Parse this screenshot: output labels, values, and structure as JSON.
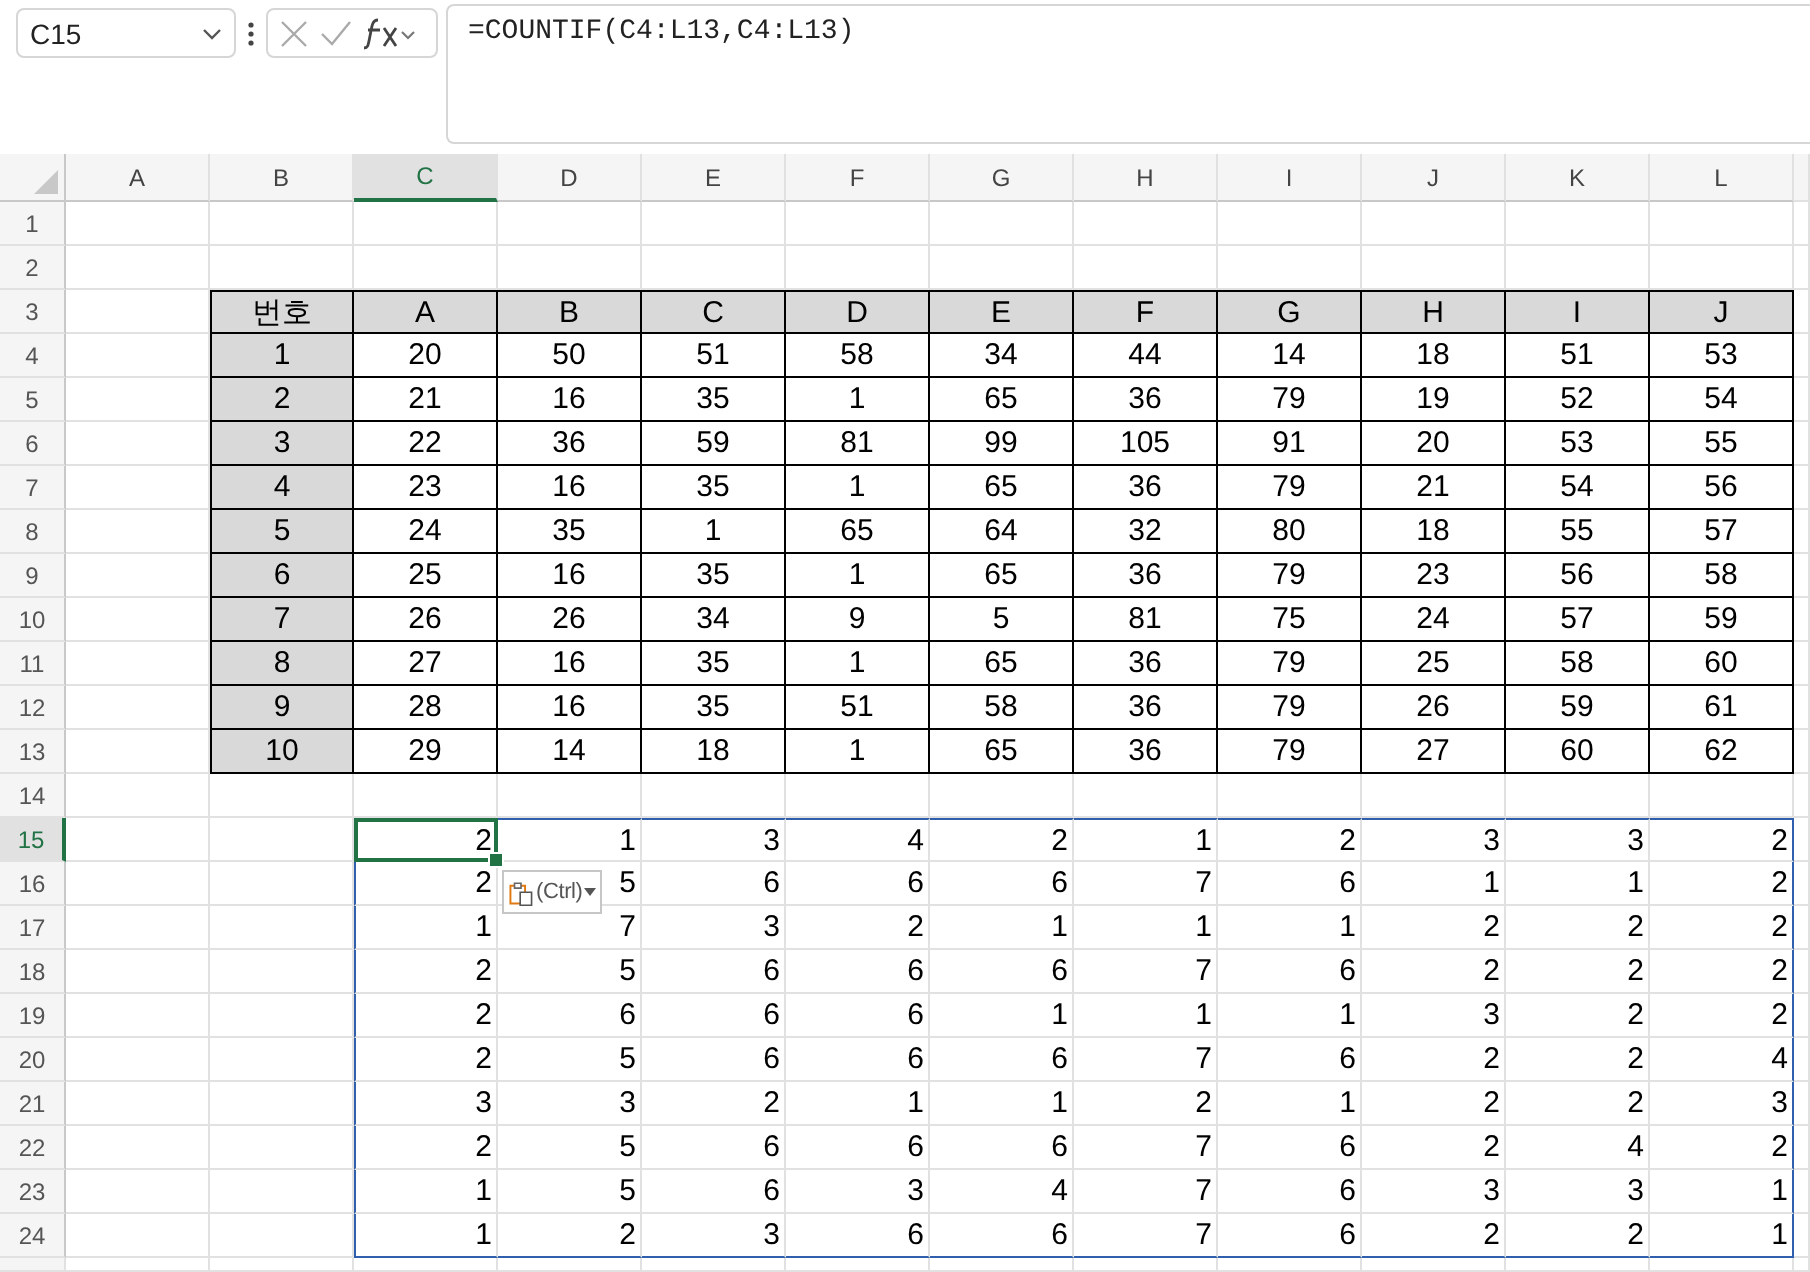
{
  "name_box": {
    "value": "C15"
  },
  "formula_bar": {
    "formula": "=COUNTIF(C4:L13,C4:L13)"
  },
  "columns": [
    {
      "label": "A",
      "selected": false
    },
    {
      "label": "B",
      "selected": false
    },
    {
      "label": "C",
      "selected": true
    },
    {
      "label": "D",
      "selected": false
    },
    {
      "label": "E",
      "selected": false
    },
    {
      "label": "F",
      "selected": false
    },
    {
      "label": "G",
      "selected": false
    },
    {
      "label": "H",
      "selected": false
    },
    {
      "label": "I",
      "selected": false
    },
    {
      "label": "J",
      "selected": false
    },
    {
      "label": "K",
      "selected": false
    },
    {
      "label": "L",
      "selected": false
    }
  ],
  "rows": [
    {
      "label": "1",
      "selected": false
    },
    {
      "label": "2",
      "selected": false
    },
    {
      "label": "3",
      "selected": false
    },
    {
      "label": "4",
      "selected": false
    },
    {
      "label": "5",
      "selected": false
    },
    {
      "label": "6",
      "selected": false
    },
    {
      "label": "7",
      "selected": false
    },
    {
      "label": "8",
      "selected": false
    },
    {
      "label": "9",
      "selected": false
    },
    {
      "label": "10",
      "selected": false
    },
    {
      "label": "11",
      "selected": false
    },
    {
      "label": "12",
      "selected": false
    },
    {
      "label": "13",
      "selected": false
    },
    {
      "label": "14",
      "selected": false
    },
    {
      "label": "15",
      "selected": true
    },
    {
      "label": "16",
      "selected": false
    },
    {
      "label": "17",
      "selected": false
    },
    {
      "label": "18",
      "selected": false
    },
    {
      "label": "19",
      "selected": false
    },
    {
      "label": "20",
      "selected": false
    },
    {
      "label": "21",
      "selected": false
    },
    {
      "label": "22",
      "selected": false
    },
    {
      "label": "23",
      "selected": false
    },
    {
      "label": "24",
      "selected": false
    }
  ],
  "table": {
    "header": [
      "번호",
      "A",
      "B",
      "C",
      "D",
      "E",
      "F",
      "G",
      "H",
      "I",
      "J"
    ],
    "rows": [
      [
        "1",
        "20",
        "50",
        "51",
        "58",
        "34",
        "44",
        "14",
        "18",
        "51",
        "53"
      ],
      [
        "2",
        "21",
        "16",
        "35",
        "1",
        "65",
        "36",
        "79",
        "19",
        "52",
        "54"
      ],
      [
        "3",
        "22",
        "36",
        "59",
        "81",
        "99",
        "105",
        "91",
        "20",
        "53",
        "55"
      ],
      [
        "4",
        "23",
        "16",
        "35",
        "1",
        "65",
        "36",
        "79",
        "21",
        "54",
        "56"
      ],
      [
        "5",
        "24",
        "35",
        "1",
        "65",
        "64",
        "32",
        "80",
        "18",
        "55",
        "57"
      ],
      [
        "6",
        "25",
        "16",
        "35",
        "1",
        "65",
        "36",
        "79",
        "23",
        "56",
        "58"
      ],
      [
        "7",
        "26",
        "26",
        "34",
        "9",
        "5",
        "81",
        "75",
        "24",
        "57",
        "59"
      ],
      [
        "8",
        "27",
        "16",
        "35",
        "1",
        "65",
        "36",
        "79",
        "25",
        "58",
        "60"
      ],
      [
        "9",
        "28",
        "16",
        "35",
        "51",
        "58",
        "36",
        "79",
        "26",
        "59",
        "61"
      ],
      [
        "10",
        "29",
        "14",
        "18",
        "1",
        "65",
        "36",
        "79",
        "27",
        "60",
        "62"
      ]
    ]
  },
  "results": [
    [
      "2",
      "1",
      "3",
      "4",
      "2",
      "1",
      "2",
      "3",
      "3",
      "2"
    ],
    [
      "2",
      "5",
      "6",
      "6",
      "6",
      "7",
      "6",
      "1",
      "1",
      "2"
    ],
    [
      "1",
      "7",
      "3",
      "2",
      "1",
      "1",
      "1",
      "2",
      "2",
      "2"
    ],
    [
      "2",
      "5",
      "6",
      "6",
      "6",
      "7",
      "6",
      "2",
      "2",
      "2"
    ],
    [
      "2",
      "6",
      "6",
      "6",
      "1",
      "1",
      "1",
      "3",
      "2",
      "2"
    ],
    [
      "2",
      "5",
      "6",
      "6",
      "6",
      "7",
      "6",
      "2",
      "2",
      "4"
    ],
    [
      "3",
      "3",
      "2",
      "1",
      "1",
      "2",
      "1",
      "2",
      "2",
      "3"
    ],
    [
      "2",
      "5",
      "6",
      "6",
      "6",
      "7",
      "6",
      "2",
      "4",
      "2"
    ],
    [
      "1",
      "5",
      "6",
      "3",
      "4",
      "7",
      "6",
      "3",
      "3",
      "1"
    ],
    [
      "1",
      "2",
      "3",
      "6",
      "6",
      "7",
      "6",
      "2",
      "2",
      "1"
    ]
  ],
  "paste_options": {
    "label": "(Ctrl)"
  }
}
